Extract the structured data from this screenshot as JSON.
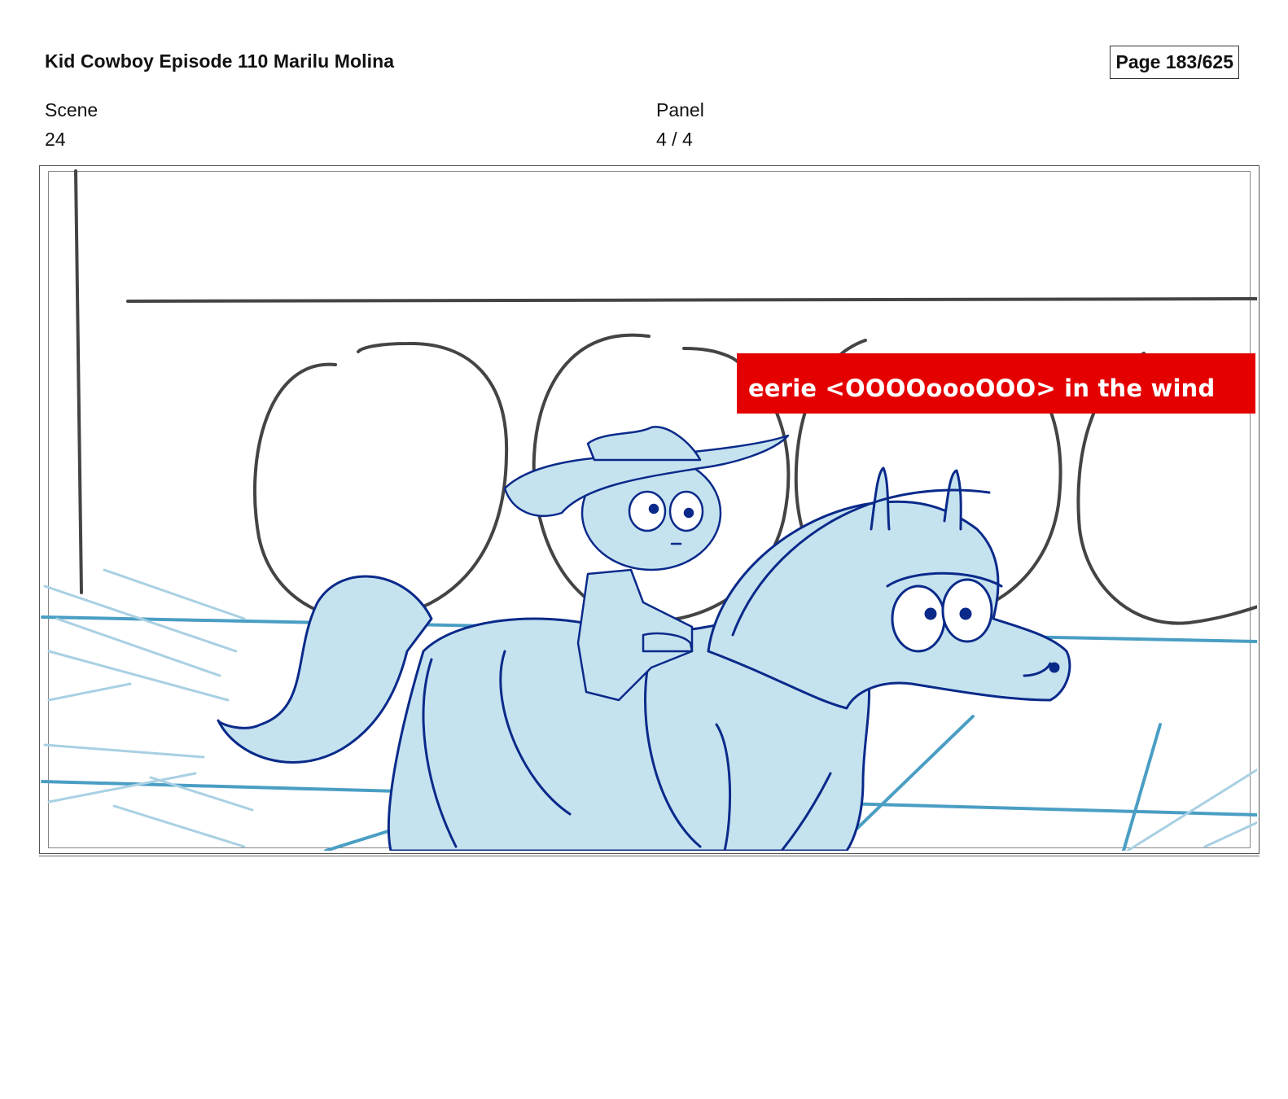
{
  "header": {
    "title": "Kid Cowboy Episode 110 Marilu Molina",
    "page": "Page 183/625"
  },
  "meta": {
    "scene_label": "Scene",
    "scene_value": "24",
    "panel_label": "Panel",
    "panel_value": "4 / 4"
  },
  "panel": {
    "caption": "eerie <OOOOoooOOO> in the wind",
    "caption_color": "#e50000",
    "fill_color": "#c5e2ef",
    "line_color": "#0a2a8a",
    "floor_color": "#4a9ec4"
  }
}
